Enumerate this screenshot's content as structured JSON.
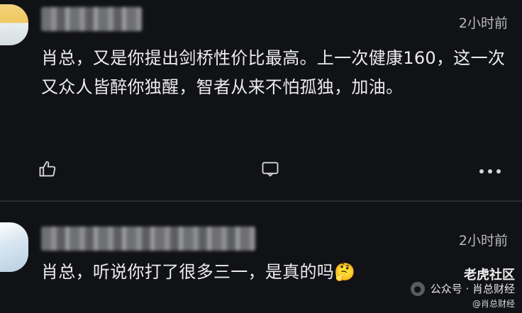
{
  "comments": [
    {
      "time": "2小时前",
      "text": "肖总，又是你提出剑桥性价比最高。上一次健康160，这一次又众人皆醉你独醒，智者从来不怕孤独，加油。",
      "actions": {
        "like_icon": "thumbs-up-icon",
        "reply_icon": "comment-icon",
        "more_icon": "more-dots-icon"
      }
    },
    {
      "time": "2小时前",
      "text": "肖总，听说你打了很多三一，是真的吗",
      "emoji": "🤔"
    }
  ],
  "watermark": {
    "brand": "老虎社区",
    "source": "公众号 · 肖总财经",
    "handle": "@肖总财经"
  }
}
